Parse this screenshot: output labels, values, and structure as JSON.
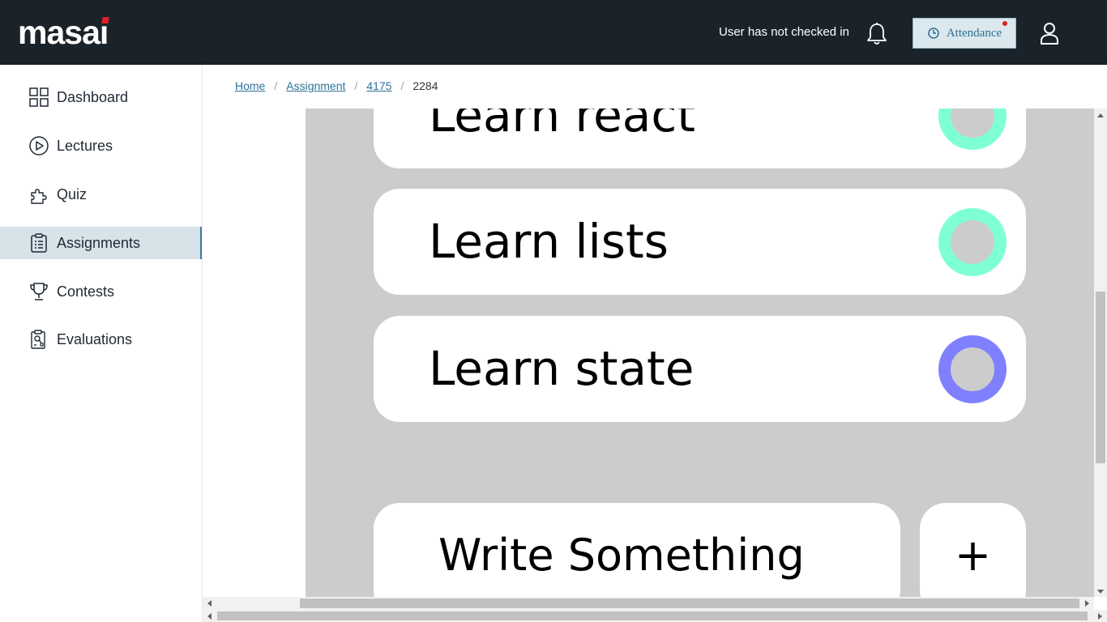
{
  "header": {
    "logo_text": "masai",
    "status_text": "User has not checked in",
    "attendance_label": "Attendance",
    "icons": [
      "bell-icon",
      "attendance-icon",
      "user-icon"
    ]
  },
  "sidebar": {
    "items": [
      {
        "label": "Dashboard",
        "icon": "grid-icon"
      },
      {
        "label": "Lectures",
        "icon": "play-circle-icon"
      },
      {
        "label": "Quiz",
        "icon": "puzzle-icon"
      },
      {
        "label": "Assignments",
        "icon": "clipboard-icon",
        "active": true
      },
      {
        "label": "Contests",
        "icon": "trophy-icon"
      },
      {
        "label": "Evaluations",
        "icon": "evaluation-icon"
      }
    ]
  },
  "breadcrumb": {
    "items": [
      "Home",
      "Assignment",
      "4175",
      "2284"
    ]
  },
  "frame": {
    "todos": [
      {
        "text": "Learn react",
        "status_color": "#7fffd4"
      },
      {
        "text": "Learn lists",
        "status_color": "#7fffd4"
      },
      {
        "text": "Learn state",
        "status_color": "#8080ff"
      }
    ],
    "input_placeholder": "Write Something",
    "add_button_label": "+"
  },
  "colors": {
    "topbar": "#1b232a",
    "accent": "#2e7198",
    "active_nav": "#d6e3e8",
    "frame_bg": "#cccccc"
  }
}
